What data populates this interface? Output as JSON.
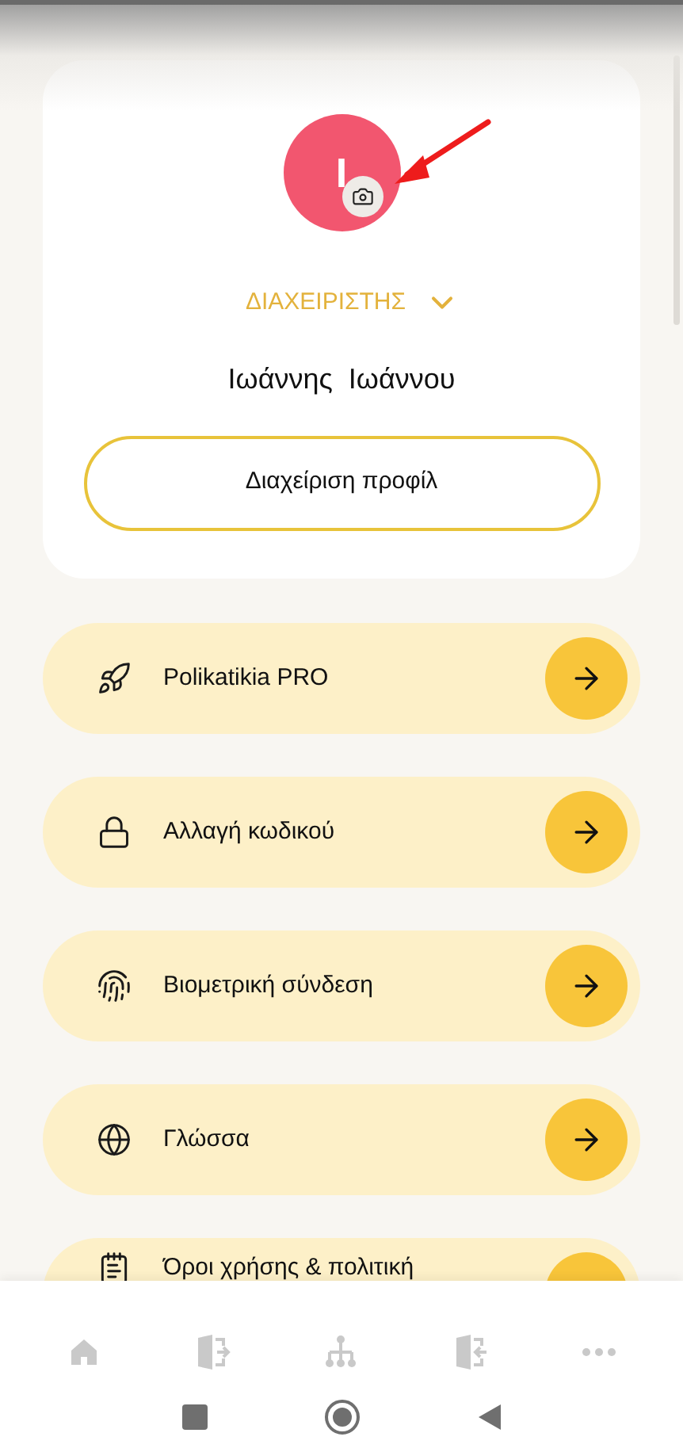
{
  "profile": {
    "avatar_initial": "I",
    "role": "ΔΙΑΧΕΙΡΙΣΤΗΣ",
    "name": "Ιωάννης  Ιωάννου",
    "manage_button": "Διαχείριση προφίλ"
  },
  "menu": [
    {
      "kind": "rocket",
      "label": "Polikatikia PRO"
    },
    {
      "kind": "lock",
      "label": "Αλλαγή κωδικού"
    },
    {
      "kind": "fingerprint",
      "label": "Βιομετρική σύνδεση"
    },
    {
      "kind": "globe",
      "label": "Γλώσσα"
    },
    {
      "kind": "document",
      "label": "Όροι χρήσης & πολιτική"
    }
  ],
  "bottom_nav": [
    {
      "kind": "home"
    },
    {
      "kind": "exit"
    },
    {
      "kind": "hierarchy"
    },
    {
      "kind": "enter"
    },
    {
      "kind": "more"
    }
  ]
}
